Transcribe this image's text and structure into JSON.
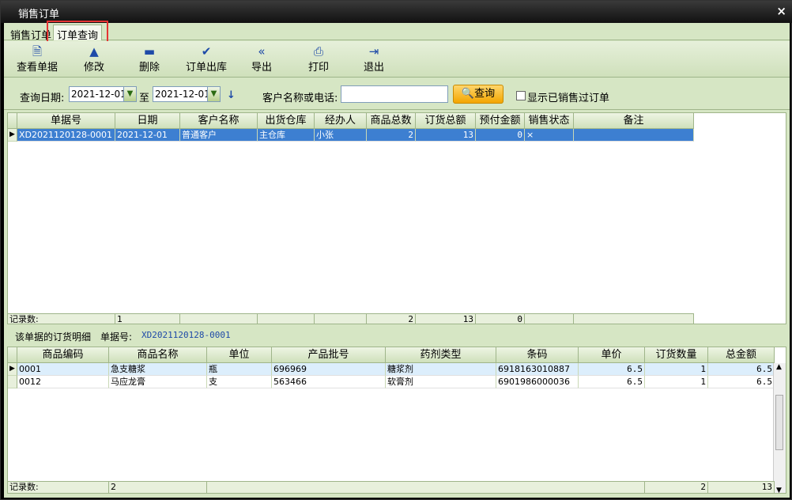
{
  "window": {
    "title": "销售订单",
    "close": "×"
  },
  "tabs": [
    "销售订单",
    "订单查询"
  ],
  "toolbar": [
    {
      "label": "查看单据",
      "icon": "document-icon"
    },
    {
      "label": "修改",
      "icon": "up-arrow-icon"
    },
    {
      "label": "删除",
      "icon": "minus-icon"
    },
    {
      "label": "订单出库",
      "icon": "check-icon"
    },
    {
      "label": "导出",
      "icon": "double-left-icon"
    },
    {
      "label": "打印",
      "icon": "printer-icon"
    },
    {
      "label": "退出",
      "icon": "exit-door-icon"
    }
  ],
  "query": {
    "date_label": "查询日期:",
    "date_from": "2021-12-01",
    "to_label": "至",
    "date_to": "2021-12-01",
    "cust_label": "客户名称或电话:",
    "cust_value": "",
    "search_btn": "查询",
    "show_sold_label": "显示已销售过订单"
  },
  "orders": {
    "columns": [
      "单据号",
      "日期",
      "客户名称",
      "出货仓库",
      "经办人",
      "商品总数",
      "订货总额",
      "预付金额",
      "销售状态",
      "备注"
    ],
    "rows": [
      [
        "XD2021120128-0001",
        "2021-12-01",
        "普通客户",
        "主仓库",
        "小张",
        "2",
        "13",
        "0",
        "×",
        ""
      ]
    ],
    "footer": {
      "label": "记录数:",
      "count": "1",
      "total_qty": "2",
      "total_amount": "13",
      "prepaid": "0"
    }
  },
  "detail": {
    "title": "该单据的订货明细",
    "doc_label": "单据号:",
    "doc_no": "XD2021120128-0001",
    "columns": [
      "商品编码",
      "商品名称",
      "单位",
      "产品批号",
      "药剂类型",
      "条码",
      "单价",
      "订货数量",
      "总金额"
    ],
    "rows": [
      [
        "0001",
        "急支糖浆",
        "瓶",
        "696969",
        "糖浆剂",
        "6918163010887",
        "6.5",
        "1",
        "6.5"
      ],
      [
        "0012",
        "马应龙膏",
        "支",
        "563466",
        "软膏剂",
        "6901986000036",
        "6.5",
        "1",
        "6.5"
      ]
    ],
    "footer": {
      "label": "记录数:",
      "count": "2",
      "qty": "2",
      "amount": "13"
    }
  }
}
